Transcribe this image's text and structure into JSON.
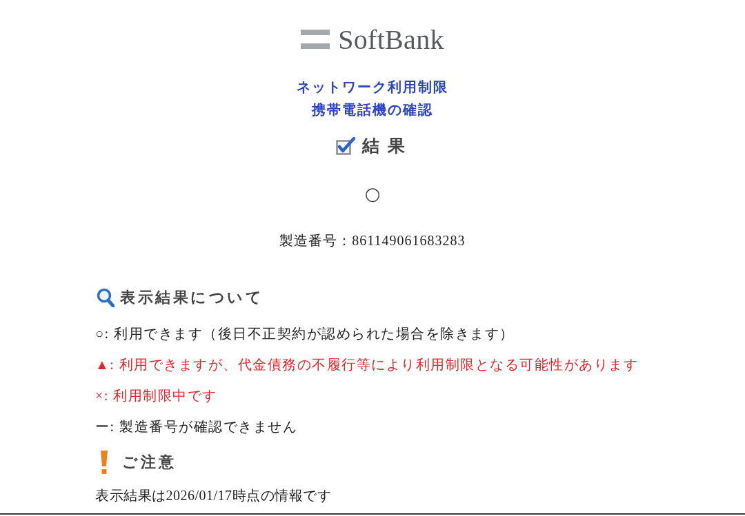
{
  "header": {
    "logo_text": "SoftBank",
    "title_lines": [
      "ネットワーク利用制限",
      "携帯電話機の確認"
    ]
  },
  "result": {
    "heading": "結 果",
    "mark": "○",
    "serial": "製造番号：861149061683283"
  },
  "legend": {
    "heading": "表示結果について",
    "items": [
      {
        "text": "○: 利用できます（後日不正契約が認められた場合を除きます）",
        "color": "#222222"
      },
      {
        "text": "▲: 利用できますが、代金債務の不履行等により利用制限となる可能性があります",
        "color": "#e0262b"
      },
      {
        "text": "×: 利用制限中です",
        "color": "#e0262b"
      },
      {
        "text": "ー: 製造番号が確認できません",
        "color": "#222222"
      }
    ]
  },
  "notice": {
    "heading": "ご注意",
    "text": "表示結果は2026/01/17時点の情報です"
  }
}
